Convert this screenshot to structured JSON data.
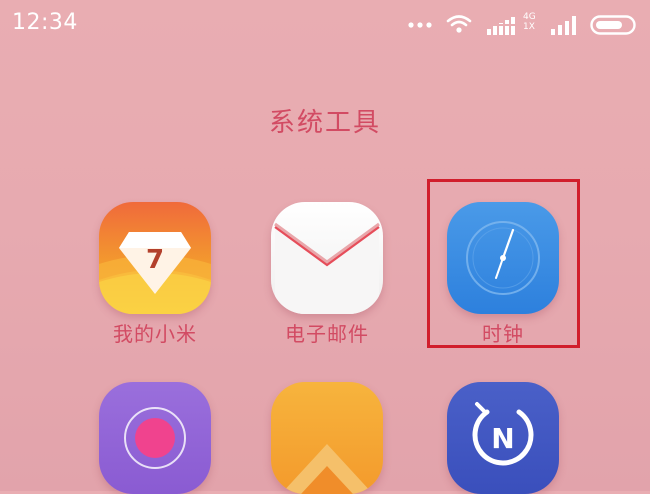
{
  "status_bar": {
    "time": "12:34",
    "network_top": "4G",
    "network_bottom": "1X",
    "icons": [
      "dots-icon",
      "wifi-icon",
      "data-bars-icon",
      "signal-icon",
      "battery-icon"
    ]
  },
  "folder": {
    "title": "系统工具"
  },
  "apps": [
    {
      "label": "我的小米",
      "icon": "mi-account-icon",
      "badge": "7"
    },
    {
      "label": "电子邮件",
      "icon": "email-icon"
    },
    {
      "label": "时钟",
      "icon": "clock-icon"
    },
    {
      "label": "",
      "icon": "record-icon"
    },
    {
      "label": "",
      "icon": "orange-app-icon"
    },
    {
      "label": "",
      "icon": "compass-n-icon",
      "letter": "N"
    }
  ],
  "colors": {
    "background": "#e9adb2",
    "label_text": "#d24b63",
    "highlight": "#d11e2c"
  }
}
